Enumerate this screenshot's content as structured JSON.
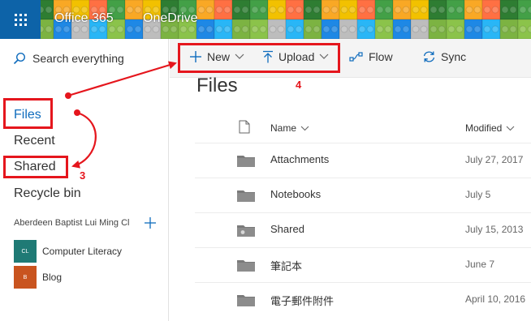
{
  "header": {
    "app_launcher_icon": "waffle-grid-icon",
    "suite_name": "Office 365",
    "app_name": "OneDrive",
    "background": "lego-bricks-theme"
  },
  "left_nav": {
    "search_placeholder": "Search everything",
    "items": [
      {
        "label": "Files",
        "selected": true
      },
      {
        "label": "Recent"
      },
      {
        "label": "Shared"
      },
      {
        "label": "Recycle bin"
      }
    ],
    "group": {
      "label": "Aberdeen Baptist Lui Ming Cl",
      "add_icon": "plus-icon",
      "sites": [
        {
          "badge": "CL",
          "name": "Computer Literacy",
          "color": "#1f7a75"
        },
        {
          "badge": "B",
          "name": "Blog",
          "color": "#c9541f"
        }
      ]
    }
  },
  "command_bar": {
    "new_label": "New",
    "upload_label": "Upload",
    "flow_label": "Flow",
    "sync_label": "Sync"
  },
  "main": {
    "title": "Files",
    "columns": {
      "name": "Name",
      "modified": "Modified"
    },
    "files": [
      {
        "name": "Attachments",
        "modified": "July 27, 2017",
        "icon": "folder-icon"
      },
      {
        "name": "Notebooks",
        "modified": "July 5",
        "icon": "folder-icon"
      },
      {
        "name": "Shared",
        "modified": "July 15, 2013",
        "icon": "shared-folder-icon"
      },
      {
        "name": "筆記本",
        "modified": "June 7",
        "icon": "folder-icon"
      },
      {
        "name": "電子郵件附件",
        "modified": "April 10, 2016",
        "icon": "folder-icon"
      }
    ]
  },
  "annotations": {
    "step_3": "3",
    "step_4": "4",
    "color": "#e5161d"
  }
}
